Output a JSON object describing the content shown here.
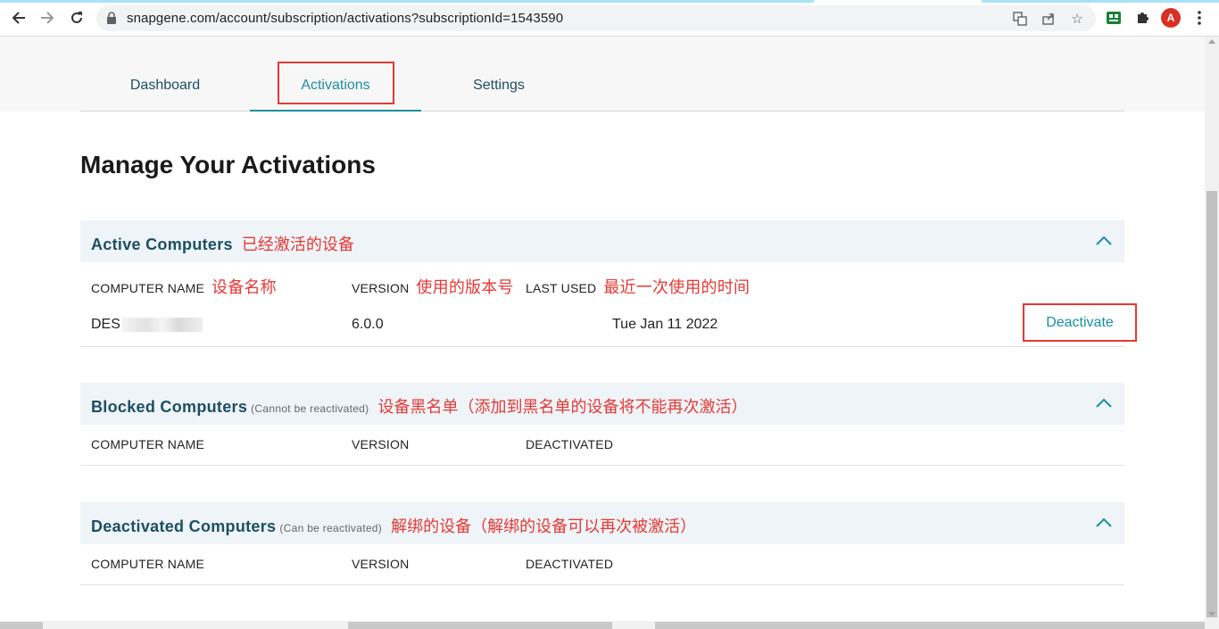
{
  "browser": {
    "url": "snapgene.com/account/subscription/activations?subscriptionId=1543590",
    "avatar_letter": "A",
    "icons": [
      "back-icon",
      "forward-icon",
      "reload-icon",
      "lock-icon",
      "translate-icon",
      "share-icon",
      "star-icon",
      "extension-green-icon",
      "puzzle-icon",
      "menu-kebab-icon"
    ]
  },
  "tabs": [
    {
      "label": "Dashboard"
    },
    {
      "label": "Activations",
      "active": true
    },
    {
      "label": "Settings"
    }
  ],
  "title": "Manage Your Activations",
  "active": {
    "title": "Active Computers",
    "annotation": "已经激活的设备",
    "columns": {
      "name": "COMPUTER NAME",
      "name_annot": "设备名称",
      "version": "VERSION",
      "version_annot": "使用的版本号",
      "last_used": "LAST USED",
      "last_used_annot": "最近一次使用的时间"
    },
    "rows": [
      {
        "name": "DES",
        "version": "6.0.0",
        "last_used": "Tue Jan 11 2022",
        "action": "Deactivate"
      }
    ]
  },
  "blocked": {
    "title": "Blocked Computers",
    "subtitle": "(Cannot be reactivated)",
    "annotation": "设备黑名单（添加到黑名单的设备将不能再次激活）",
    "columns": {
      "name": "COMPUTER NAME",
      "version": "VERSION",
      "deactivated": "DEACTIVATED"
    }
  },
  "deactivated": {
    "title": "Deactivated Computers",
    "subtitle": "(Can be reactivated)",
    "annotation": "解绑的设备（解绑的设备可以再次被激活）",
    "columns": {
      "name": "COMPUTER NAME",
      "version": "VERSION",
      "deactivated": "DEACTIVATED"
    }
  },
  "colors": {
    "accent": "#1b8fa0",
    "heading": "#1d4e63",
    "annotation_red": "#e53935",
    "section_bg": "#eef4f7"
  }
}
